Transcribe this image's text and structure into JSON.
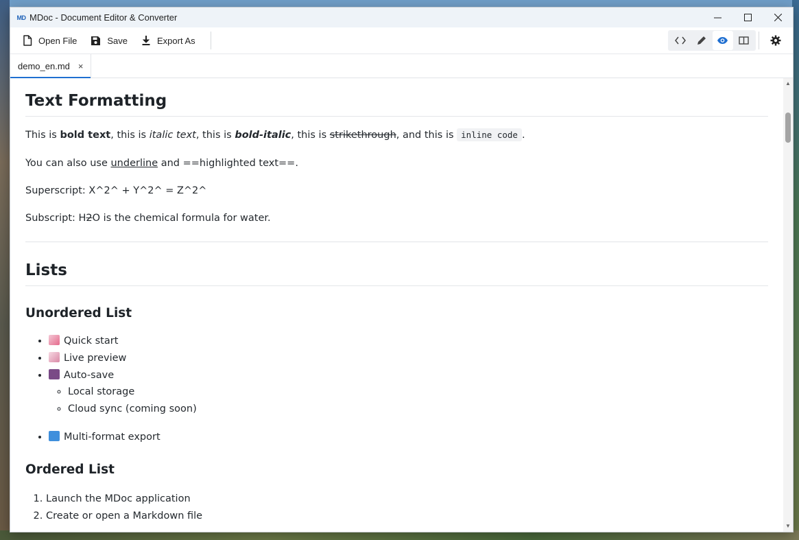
{
  "window": {
    "title": "MDoc - Document Editor & Converter",
    "logo_text": "MD"
  },
  "toolbar": {
    "open_label": "Open File",
    "save_label": "Save",
    "export_label": "Export As"
  },
  "tab": {
    "label": "demo_en.md",
    "close": "×"
  },
  "document": {
    "text_formatting": {
      "heading": "Text Formatting",
      "p1": {
        "a": "This is ",
        "bold": "bold text",
        "b": ", this is ",
        "italic": "italic text",
        "c": ", this is ",
        "bold_italic": "bold-italic",
        "d": ", this is ",
        "strike": "strikethrough",
        "e": ", and this is ",
        "code": "inline code",
        "f": "."
      },
      "p2": {
        "a": "You can also use ",
        "underline": "underline",
        "b": " and ==highlighted text==."
      },
      "p3": "Superscript: X^2^ + Y^2^ = Z^2^",
      "p4": {
        "a": "Subscript: H",
        "strike": "2",
        "b": "O is the chemical formula for water."
      }
    },
    "lists": {
      "heading": "Lists",
      "unordered_heading": "Unordered List",
      "unordered": [
        {
          "icon": "rocket-emoji",
          "label": "Quick start"
        },
        {
          "icon": "memo-emoji",
          "label": "Live preview"
        },
        {
          "icon": "floppy-disk-emoji",
          "label": "Auto-save"
        },
        {
          "icon": "arrows-cycle-emoji",
          "label": "Multi-format export"
        }
      ],
      "nested": [
        "Local storage",
        "Cloud sync (coming soon)"
      ],
      "ordered_heading": "Ordered List",
      "ordered": [
        "Launch the MDoc application",
        "Create or open a Markdown file"
      ]
    }
  },
  "colors": {
    "accent": "#1f6fd1",
    "link_icon": "#1f62b8"
  }
}
